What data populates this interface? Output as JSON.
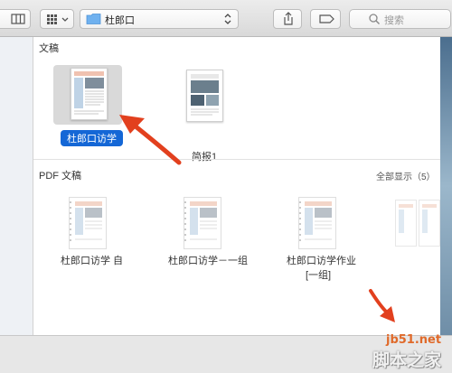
{
  "toolbar": {
    "location": "杜郎口",
    "search_placeholder": "搜索"
  },
  "recent": {
    "title": "文稿",
    "items": [
      {
        "label": "杜郎口访学",
        "selected": true
      },
      {
        "label": "简报1",
        "selected": false
      }
    ]
  },
  "pdf": {
    "title": "PDF 文稿",
    "show_all": "全部显示（5）",
    "items": [
      {
        "label": "杜郎口访学 自"
      },
      {
        "label": "杜郎口访学－一组"
      },
      {
        "label": "杜郎口访学作业",
        "label2": "[一组]"
      }
    ]
  },
  "watermark": {
    "domain": "jb51.net",
    "name": "脚本之家"
  },
  "colors": {
    "selection": "#1467d6",
    "arrow": "#e2401e"
  }
}
